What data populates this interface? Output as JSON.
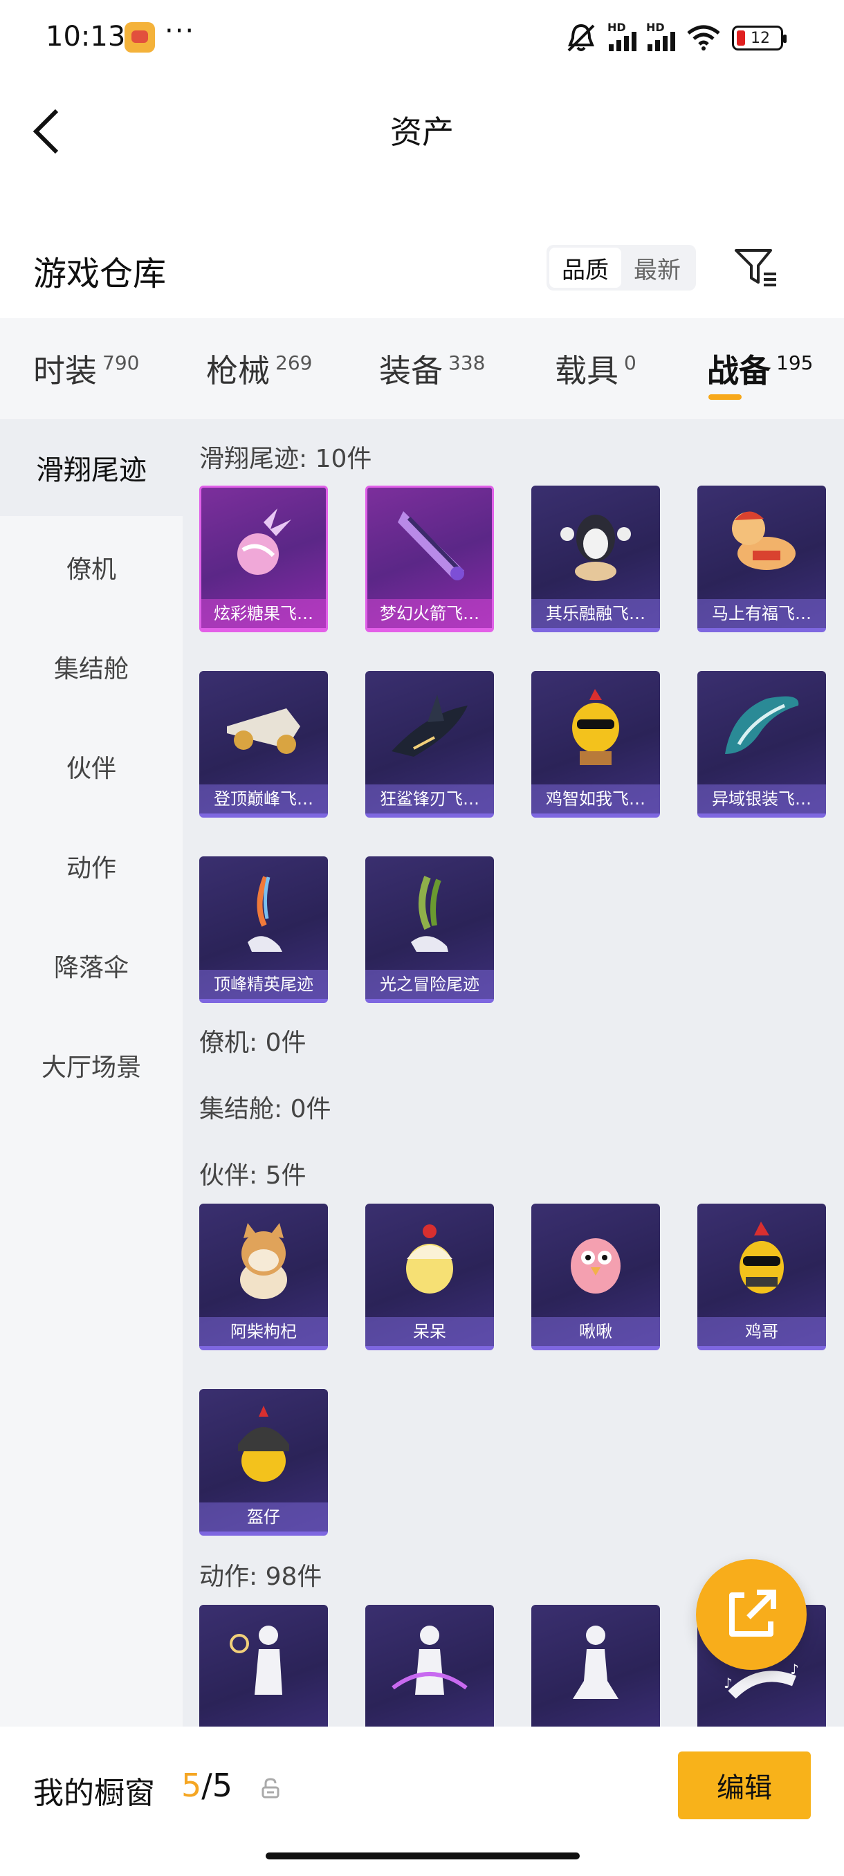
{
  "status_bar": {
    "time": "10:13",
    "battery": "12",
    "signal_label": "HD"
  },
  "header": {
    "title": "资产"
  },
  "warehouse": {
    "title": "游戏仓库",
    "sort_options": [
      "品质",
      "最新"
    ],
    "active_sort": "品质"
  },
  "tabs": [
    {
      "label": "时装",
      "count": "790"
    },
    {
      "label": "枪械",
      "count": "269"
    },
    {
      "label": "装备",
      "count": "338"
    },
    {
      "label": "载具",
      "count": "0"
    },
    {
      "label": "战备",
      "count": "195"
    }
  ],
  "active_tab": "战备",
  "accent_color": "#f8b21a",
  "sidebar": [
    {
      "label": "滑翔尾迹"
    },
    {
      "label": "僚机"
    },
    {
      "label": "集结舱"
    },
    {
      "label": "伙伴"
    },
    {
      "label": "动作"
    },
    {
      "label": "降落伞"
    },
    {
      "label": "大厅场景"
    }
  ],
  "sections": {
    "glide_trails": {
      "title": "滑翔尾迹: 10件",
      "items": [
        {
          "name": "炫彩糖果飞…",
          "rarity": "legendary"
        },
        {
          "name": "梦幻火箭飞…",
          "rarity": "legendary"
        },
        {
          "name": "其乐融融飞…",
          "rarity": "epic"
        },
        {
          "name": "马上有福飞…",
          "rarity": "epic"
        },
        {
          "name": "登顶巅峰飞…",
          "rarity": "epic"
        },
        {
          "name": "狂鲨锋刃飞…",
          "rarity": "epic"
        },
        {
          "name": "鸡智如我飞…",
          "rarity": "epic"
        },
        {
          "name": "异域银装飞…",
          "rarity": "epic"
        },
        {
          "name": "顶峰精英尾迹",
          "rarity": "epic"
        },
        {
          "name": "光之冒险尾迹",
          "rarity": "epic"
        }
      ]
    },
    "wingman": {
      "title": "僚机: 0件"
    },
    "capsule": {
      "title": "集结舱: 0件"
    },
    "partners": {
      "title": "伙伴: 5件",
      "items": [
        {
          "name": "阿柴枸杞"
        },
        {
          "name": "呆呆"
        },
        {
          "name": "啾啾"
        },
        {
          "name": "鸡哥"
        },
        {
          "name": "盔仔"
        }
      ]
    },
    "emotes": {
      "title": "动作: 98件"
    }
  },
  "bottom_bar": {
    "showcase_label": "我的橱窗",
    "showcase_current": "5",
    "showcase_total": "/5",
    "edit_label": "编辑"
  }
}
